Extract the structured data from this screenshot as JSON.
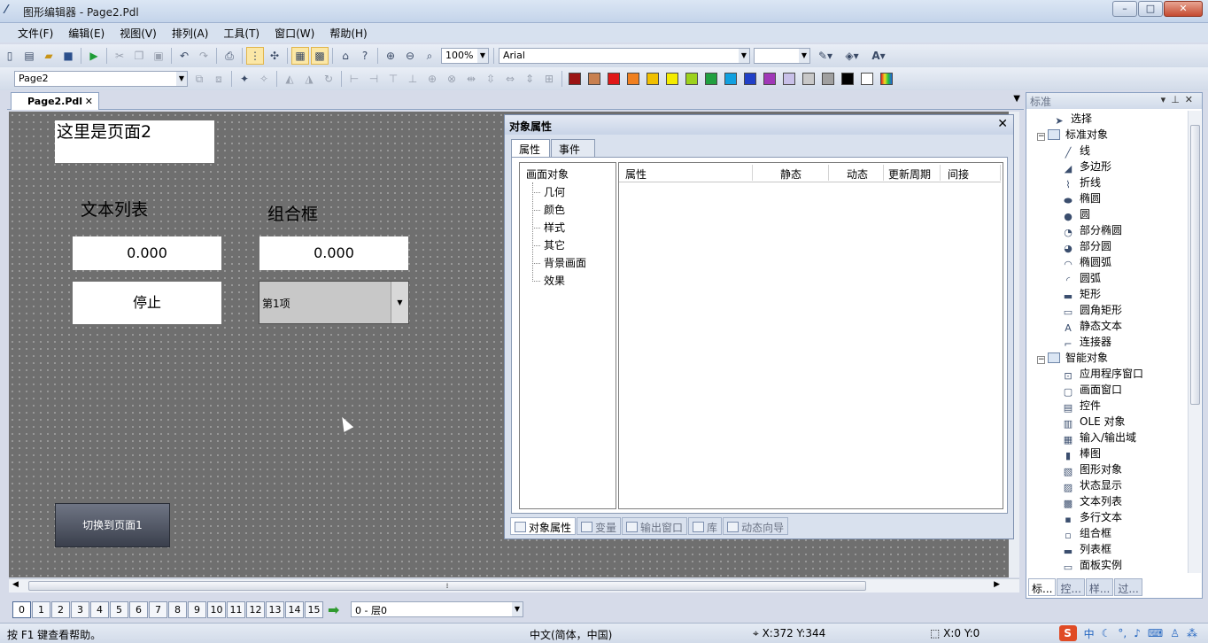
{
  "window": {
    "title": "图形编辑器 - Page2.Pdl",
    "controls": [
      "–",
      "□",
      "✕"
    ]
  },
  "menu": [
    "文件(F)",
    "编辑(E)",
    "视图(V)",
    "排列(A)",
    "工具(T)",
    "窗口(W)",
    "帮助(H)"
  ],
  "toolbar1": {
    "zoom": "100%",
    "font": "Arial",
    "font_size": ""
  },
  "toolbar2": {
    "page_select": "Page2",
    "palette": [
      "#9b1414",
      "#c88050",
      "#e01818",
      "#f08020",
      "#f0c000",
      "#f4ec00",
      "#9cd21c",
      "#20a040",
      "#10a0e0",
      "#2040c8",
      "#a038b8",
      "#c8c0e8",
      "#c8c8c8",
      "#a0a0a0",
      "#000000",
      "#ffffff"
    ]
  },
  "doc_tab": {
    "label": "Page2.Pdl",
    "close": "✕"
  },
  "canvas": {
    "page_title": "这里是页面2",
    "label_text_list": "文本列表",
    "label_combo_box": "组合框",
    "field1_value": "0.000",
    "field2_value": "0.000",
    "stop_button": "停止",
    "combo_value": "第1项",
    "switch_button": "切换到页面1"
  },
  "properties": {
    "title": "对象属性",
    "tabs": [
      "属性",
      "事件"
    ],
    "tree_root": "画面对象",
    "tree_items": [
      "几何",
      "颜色",
      "样式",
      "其它",
      "背景画面",
      "效果"
    ],
    "columns": [
      "属性",
      "静态",
      "动态",
      "更新周期",
      "间接"
    ],
    "bottom_tabs": [
      "对象属性",
      "变量",
      "输出窗口",
      "库",
      "动态向导"
    ]
  },
  "standard_panel": {
    "title": "标准",
    "select": "选择",
    "group_standard": "标准对象",
    "standard_items": [
      "线",
      "多边形",
      "折线",
      "椭圆",
      "圆",
      "部分椭圆",
      "部分圆",
      "椭圆弧",
      "圆弧",
      "矩形",
      "圆角矩形",
      "静态文本",
      "连接器"
    ],
    "group_smart": "智能对象",
    "smart_items": [
      "应用程序窗口",
      "画面窗口",
      "控件",
      "OLE 对象",
      "输入/输出域",
      "棒图",
      "图形对象",
      "状态显示",
      "文本列表",
      "多行文本",
      "组合框",
      "列表框",
      "面板实例"
    ],
    "bottom_tabs": [
      "标...",
      "控...",
      "样...",
      "过..."
    ]
  },
  "layers": {
    "numbers": [
      "0",
      "1",
      "2",
      "3",
      "4",
      "5",
      "6",
      "7",
      "8",
      "9",
      "10",
      "11",
      "12",
      "13",
      "14",
      "15"
    ],
    "current": "0 - 层0"
  },
  "status": {
    "help": "按 F1 键查看帮助。",
    "lang": "中文(简体，中国)",
    "xy": "X:372 Y:344",
    "size": "X:0 Y:0",
    "ime": "中"
  }
}
